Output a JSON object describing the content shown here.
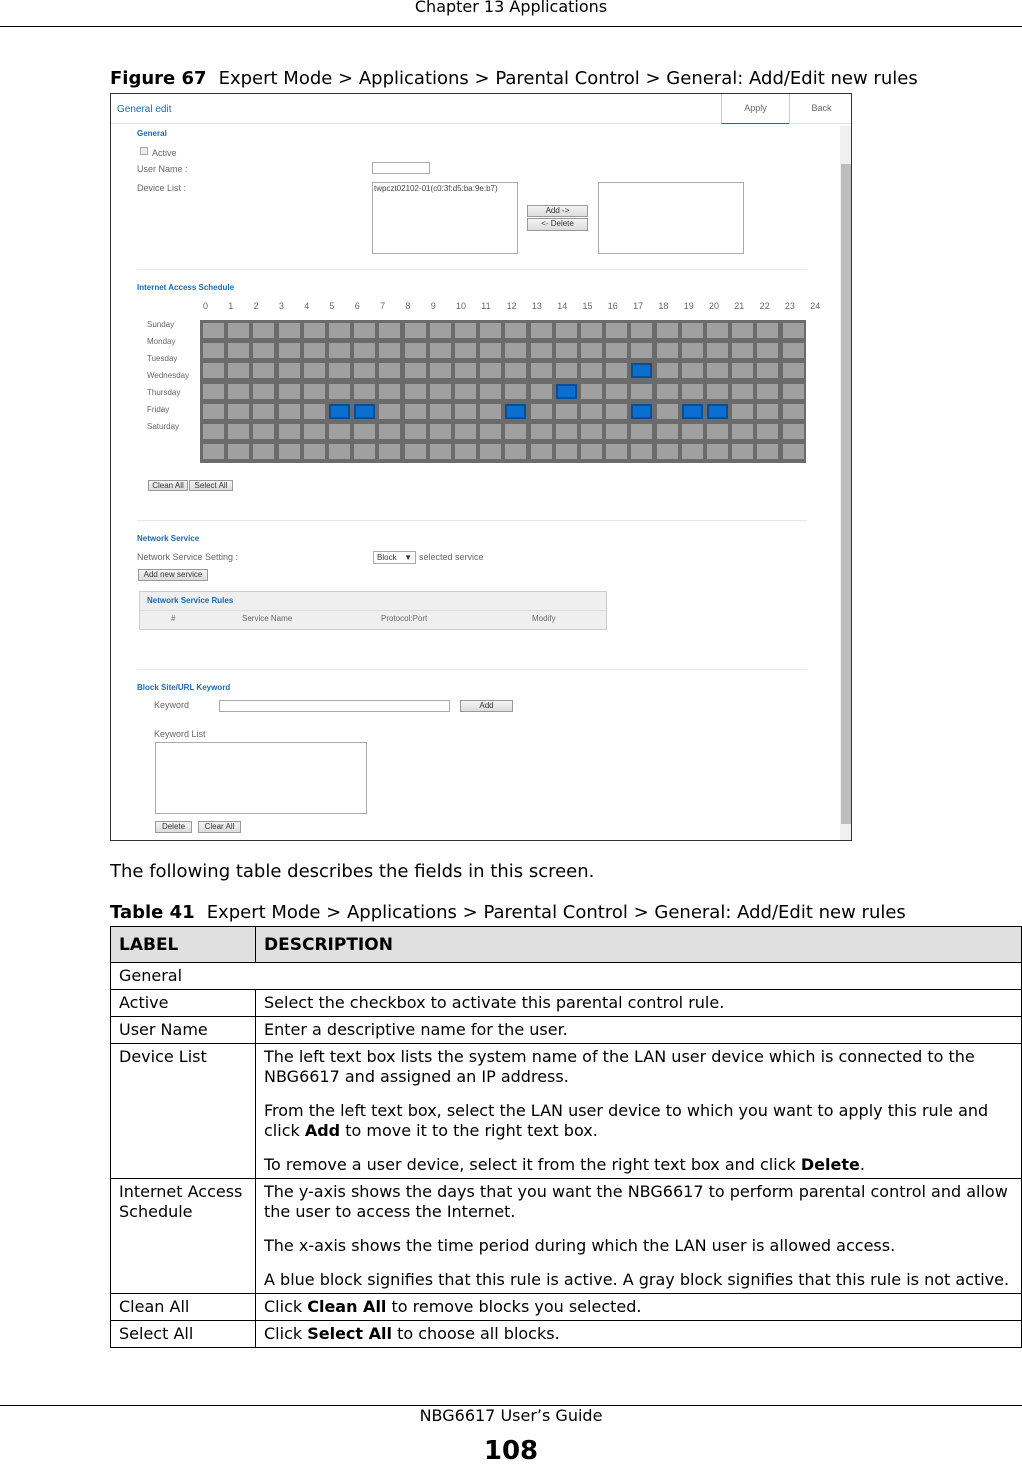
{
  "header": "Chapter 13 Applications",
  "figure": {
    "label": "Figure 67",
    "title": "Expert Mode > Applications > Parental Control > General: Add/Edit new rules"
  },
  "ui": {
    "tab": "General edit",
    "apply": "Apply",
    "back": "Back",
    "general": {
      "heading": "General",
      "active": "Active",
      "user_name": "User Name :",
      "device_list": "Device List :",
      "device_item": "twpczt02102-01(c0:3f:d5:ba:9e:b7)",
      "add": "Add ->",
      "delete": "<- Delete"
    },
    "schedule": {
      "heading": "Internet Access Schedule",
      "hours": [
        "0",
        "1",
        "2",
        "3",
        "4",
        "5",
        "6",
        "7",
        "8",
        "9",
        "10",
        "11",
        "12",
        "13",
        "14",
        "15",
        "16",
        "17",
        "18",
        "19",
        "20",
        "21",
        "22",
        "23",
        "24"
      ],
      "days": [
        "Sunday",
        "Monday",
        "Tuesday",
        "Wednesday",
        "Thursday",
        "Friday",
        "Saturday"
      ],
      "active_cells": [
        [
          2,
          17
        ],
        [
          3,
          14
        ],
        [
          4,
          5
        ],
        [
          4,
          6
        ],
        [
          4,
          12
        ],
        [
          4,
          17
        ],
        [
          4,
          19
        ],
        [
          4,
          20
        ]
      ],
      "active_color": "#0a6fd0",
      "inactive_color": "#a0a0a0",
      "clean_all": "Clean All",
      "select_all": "Select All"
    },
    "network": {
      "heading": "Network Service",
      "setting": "Network Service Setting :",
      "select": "Block",
      "selected_service": "selected service",
      "add_new": "Add new service",
      "rules_title": "Network Service Rules",
      "cols": [
        "#",
        "Service Name",
        "Protocol:Port",
        "Modify"
      ]
    },
    "block": {
      "heading": "Block Site/URL Keyword",
      "keyword": "Keyword",
      "add": "Add",
      "keyword_list": "Keyword List",
      "delete": "Delete",
      "clear_all": "Clear All"
    }
  },
  "intro": "The following table describes the fields in this screen.",
  "table": {
    "label": "Table 41",
    "title": "Expert Mode > Applications > Parental Control > General: Add/Edit new rules",
    "headers": [
      "LABEL",
      "DESCRIPTION"
    ],
    "section": "General",
    "rows": [
      {
        "label": "Active",
        "desc": [
          "Select the checkbox to activate this parental control rule."
        ]
      },
      {
        "label": "User Name",
        "desc": [
          "Enter a descriptive name for the user."
        ]
      },
      {
        "label": "Device List",
        "desc": [
          "The left text box lists the system name of the LAN user device which is connected to the NBG6617 and assigned an IP address.",
          "From the left text box, select the LAN user device to which you want to apply this rule and click <b>Add</b> to move it to the right text box.",
          "To remove a user device, select it from the right text box and click <b>Delete</b>."
        ]
      },
      {
        "label": "Internet Access Schedule",
        "desc": [
          "The y-axis shows the days that you want the NBG6617 to perform parental control and allow the user to access the Internet.",
          "The x-axis shows the time period during which the LAN user is allowed access.",
          "A blue block signifies that this rule is active. A gray block signifies that this rule is not active."
        ]
      },
      {
        "label": "Clean All",
        "desc": [
          "Click <b>Clean All</b> to remove blocks you selected."
        ]
      },
      {
        "label": "Select All",
        "desc": [
          "Click <b>Select All</b> to choose all blocks."
        ]
      }
    ]
  },
  "footer": "NBG6617 User’s Guide",
  "page": "108"
}
